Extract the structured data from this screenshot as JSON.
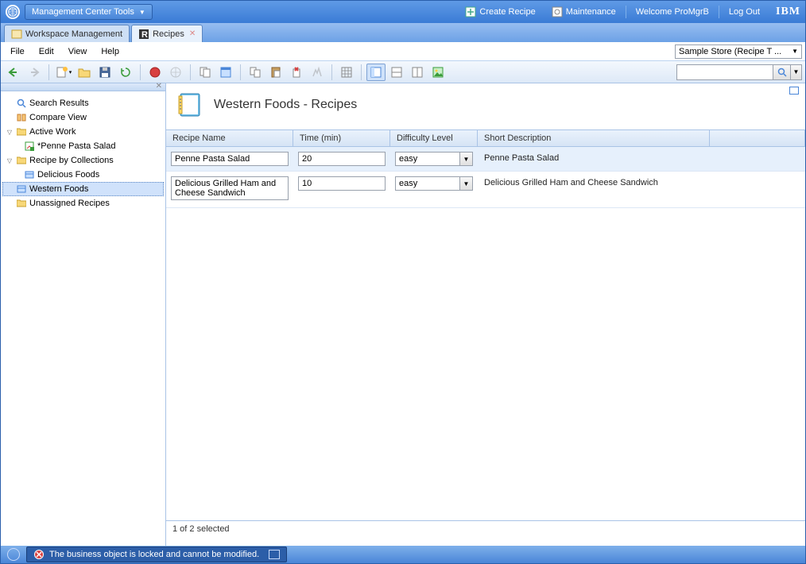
{
  "titlebar": {
    "tools_label": "Management Center Tools",
    "create_recipe": "Create Recipe",
    "maintenance": "Maintenance",
    "welcome": "Welcome ProMgrB",
    "logout": "Log Out",
    "ibm": "IBM"
  },
  "tabs": {
    "workspace": "Workspace Management",
    "recipes": "Recipes"
  },
  "menus": {
    "file": "File",
    "edit": "Edit",
    "view": "View",
    "help": "Help"
  },
  "store_selector": "Sample Store (Recipe T ...",
  "tree": {
    "search_results": "Search Results",
    "compare_view": "Compare View",
    "active_work": "Active Work",
    "penne": "*Penne Pasta Salad",
    "recipe_by_collections": "Recipe by Collections",
    "delicious_foods": "Delicious Foods",
    "western_foods": "Western Foods",
    "unassigned_recipes": "Unassigned Recipes"
  },
  "main": {
    "title": "Western Foods - Recipes"
  },
  "grid": {
    "headers": {
      "name": "Recipe Name",
      "time": "Time (min)",
      "difficulty": "Difficulty Level",
      "desc": "Short Description"
    },
    "rows": [
      {
        "name": "Penne Pasta Salad",
        "time": "20",
        "difficulty": "easy",
        "desc": "Penne Pasta Salad"
      },
      {
        "name": "Delicious Grilled Ham and Cheese Sandwich",
        "time": "10",
        "difficulty": "easy",
        "desc": "Delicious Grilled Ham and Cheese Sandwich"
      }
    ],
    "status": "1 of 2 selected"
  },
  "statusbar": {
    "message": "The business object is locked and cannot be modified."
  }
}
